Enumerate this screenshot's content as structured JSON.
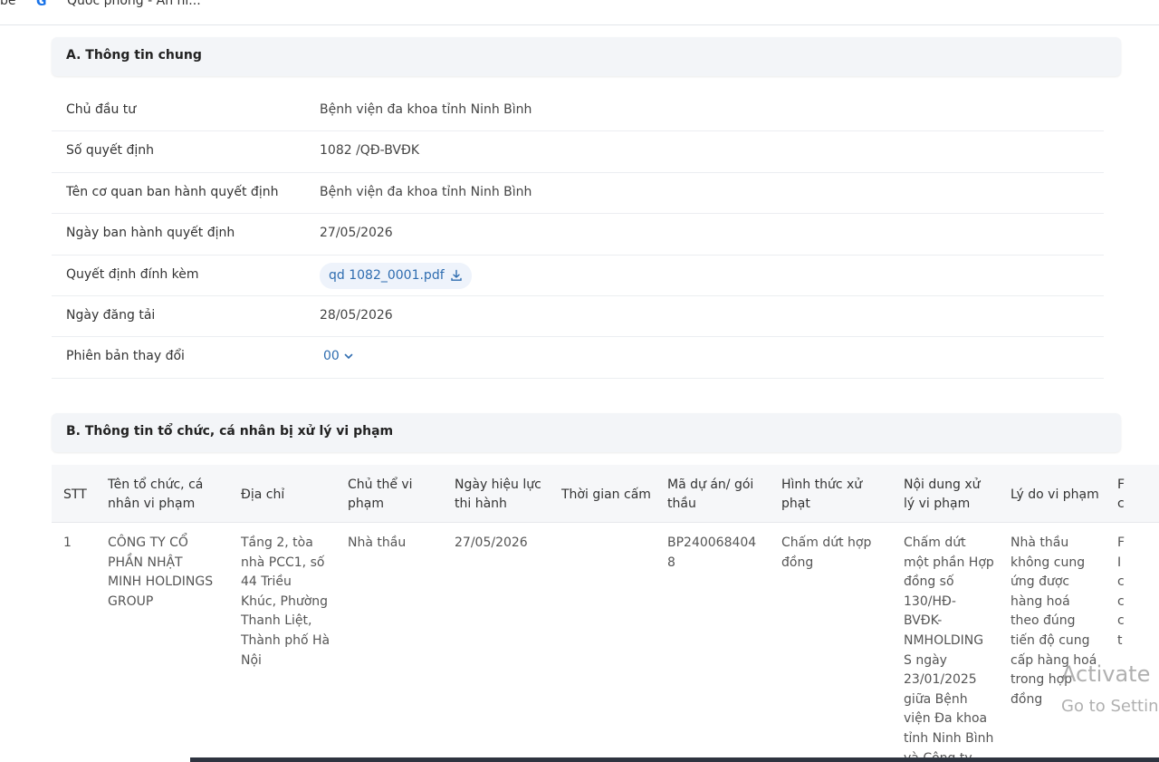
{
  "topbar": {
    "fragment_left": "be",
    "fragment_right": "Quốc phòng - An ni..."
  },
  "section_a": {
    "title": "A. Thông tin chung",
    "rows": [
      {
        "label": "Chủ đầu tư",
        "value": "Bệnh viện đa khoa tỉnh Ninh Bình"
      },
      {
        "label": "Số quyết định",
        "value": "1082 /QĐ-BVĐK"
      },
      {
        "label": "Tên cơ quan ban hành quyết định",
        "value": "Bệnh viện đa khoa tỉnh Ninh Bình"
      },
      {
        "label": "Ngày ban hành quyết định",
        "value": "27/05/2026"
      },
      {
        "label": "Quyết định đính kèm",
        "value": "qd 1082_0001.pdf"
      },
      {
        "label": "Ngày đăng tải",
        "value": "28/05/2026"
      },
      {
        "label": "Phiên bản thay đổi",
        "value": "00"
      }
    ]
  },
  "section_b": {
    "title": "B. Thông tin tổ chức, cá nhân bị xử lý vi phạm",
    "columns": [
      "STT",
      "Tên tổ chức, cá\nnhân vi phạm",
      "Địa chỉ",
      "Chủ thể vi\nphạm",
      "Ngày hiệu lực\nthi hành",
      "Thời gian cấm",
      "Mã dự án/ gói\nthầu",
      "Hình thức xử\nphạt",
      "Nội dung xử\nlý vi phạm",
      "Lý do vi phạm",
      "F\nc"
    ],
    "rows": [
      {
        "stt": "1",
        "ten": "CÔNG TY CỔ\nPHẦN NHẬT\nMINH HOLDINGS\nGROUP",
        "dia_chi": "Tầng 2, tòa\nnhà PCC1, số\n44 Triều\nKhúc, Phường\nThanh Liệt,\nThành phố Hà\nNội",
        "chu_the": "Nhà thầu",
        "ngay_hieu_luc": "27/05/2026",
        "thoi_gian_cam": "",
        "ma_du_an": "BP240068404\n8",
        "hinh_thuc": "Chấm dứt hợp\nđồng",
        "noi_dung": "Chấm dứt\nmột phần Hợp\nđồng số\n130/HĐ-\nBVĐK-\nNMHOLDING\nS ngày\n23/01/2025\ngiữa Bệnh\nviện Đa khoa\ntỉnh Ninh Bình\nvà Công ty",
        "ly_do": "Nhà thầu\nkhông cung\nứng được\nhàng hoá\ntheo đúng\ntiến độ cung\ncấp hàng hoá\ntrong hợp\nđồng",
        "cut_col": "F\nI\nc\nc\nc\nt"
      }
    ]
  },
  "watermark": {
    "line1": "Activate",
    "line2": "Go to Settin"
  }
}
